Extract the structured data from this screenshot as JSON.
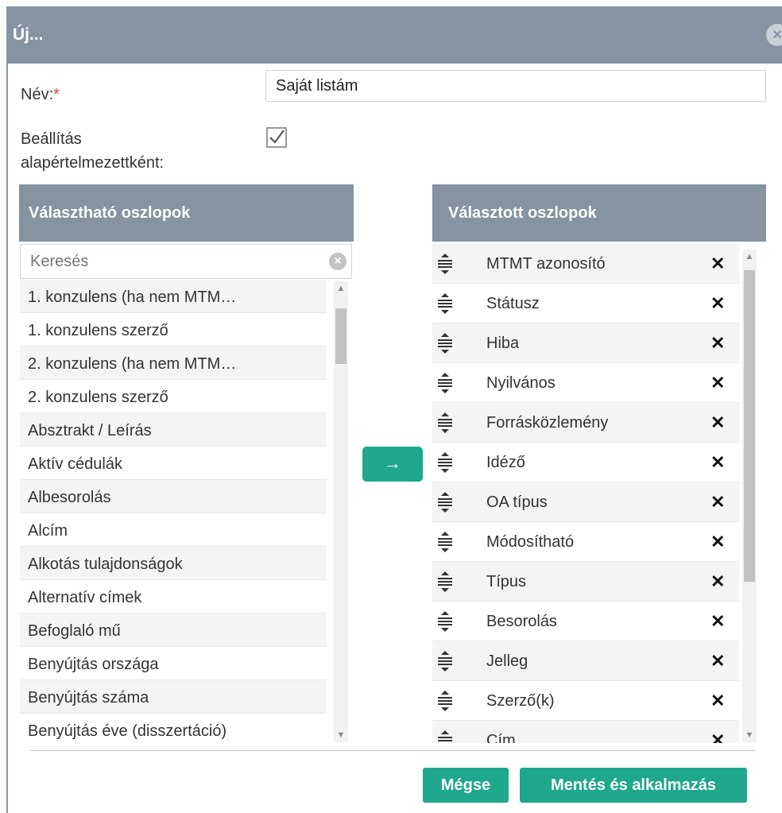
{
  "dialog": {
    "title": "Új...",
    "close_icon": "close-circle-icon"
  },
  "form": {
    "name_label": "Név:",
    "required_mark": "*",
    "name_value": "Saját listám",
    "default_label_line1": "Beállítás",
    "default_label_line2": "alapértelmezettként:",
    "default_checked": true
  },
  "available": {
    "header": "Választható oszlopok",
    "search_placeholder": "Keresés",
    "items": [
      "1. konzulens (ha nem MTM…",
      "1. konzulens szerző",
      "2. konzulens (ha nem MTM…",
      "2. konzulens szerző",
      "Absztrakt / Leírás",
      "Aktív cédulák",
      "Albesorolás",
      "Alcím",
      "Alkotás tulajdonságok",
      "Alternatív címek",
      "Befoglaló mű",
      "Benyújtás országa",
      "Benyújtás száma",
      "Benyújtás éve (disszertáció)"
    ]
  },
  "move_button": {
    "icon": "arrow-right-icon",
    "label": "→"
  },
  "chosen": {
    "header": "Választott oszlopok",
    "remove_label": "✕",
    "items": [
      "MTMT azonosító",
      "Státusz",
      "Hiba",
      "Nyilvános",
      "Forrásközlemény",
      "Idéző",
      "OA típus",
      "Módosítható",
      "Típus",
      "Besorolás",
      "Jelleg",
      "Szerző(k)",
      "Cím"
    ]
  },
  "footer": {
    "cancel_label": "Mégse",
    "save_label": "Mentés és alkalmazás"
  },
  "colors": {
    "header_bg": "#8593a3",
    "accent": "#1fa88c",
    "required": "#e23a3a"
  }
}
